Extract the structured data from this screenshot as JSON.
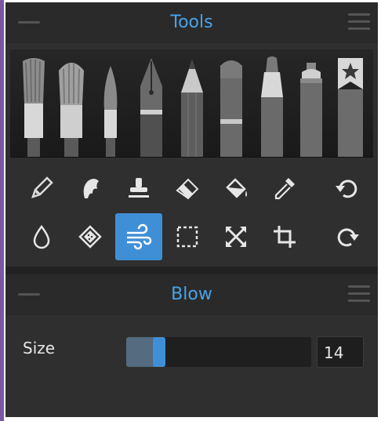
{
  "tools_panel": {
    "title": "Tools",
    "brushes": [
      {
        "name": "flat-brush"
      },
      {
        "name": "wide-brush"
      },
      {
        "name": "round-brush"
      },
      {
        "name": "pen-nib"
      },
      {
        "name": "pencil"
      },
      {
        "name": "marker"
      },
      {
        "name": "felt-tip"
      },
      {
        "name": "spray-can"
      },
      {
        "name": "favorites"
      }
    ],
    "tools_row_1": [
      "eraser-pencil",
      "smudge",
      "stamp",
      "eraser",
      "fill-bucket",
      "eyedropper",
      "undo"
    ],
    "tools_row_2": [
      "water-drop",
      "texture-patch",
      "blow",
      "selection",
      "transform",
      "crop",
      "redo"
    ],
    "active_tool": "blow"
  },
  "blow_panel": {
    "title": "Blow",
    "size_label": "Size",
    "size_value": "14",
    "size_fraction": 0.18
  },
  "colors": {
    "accent": "#3f8fd6",
    "title": "#4aa3e8",
    "panel_bg": "#2f2f2f",
    "header_bg": "#2a2a2a"
  }
}
